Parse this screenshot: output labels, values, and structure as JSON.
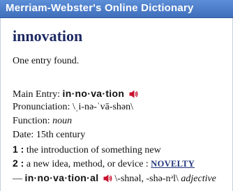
{
  "banner": {
    "title": "Merriam-Webster's Online Dictionary"
  },
  "entry": {
    "headword": "innovation",
    "count_text": "One entry found.",
    "main_entry": {
      "label": "Main Entry:",
      "value": "in·no·va·tion"
    },
    "pronunciation": {
      "label": "Pronunciation:",
      "value": "\\ˌi-nə-ˈvā-shən\\"
    },
    "function": {
      "label": "Function:",
      "value": "noun"
    },
    "date": {
      "label": "Date:",
      "value": "15th century"
    },
    "senses": [
      {
        "number": "1",
        "colon": " :",
        "text": " the introduction of something new"
      },
      {
        "number": "2",
        "colon": " :",
        "text": " a new idea, method, or device : ",
        "link": "NOVELTY"
      }
    ],
    "derived": {
      "dash": "—",
      "word": "in·no·va·tion·al",
      "pronunciation": "\\-shnəl, -shə-nᵊl\\",
      "function": "adjective"
    }
  },
  "colors": {
    "banner": "#4a7cc7",
    "headword": "#1e2a63",
    "speaker_red": "#c8102e",
    "link": "#23357a"
  }
}
